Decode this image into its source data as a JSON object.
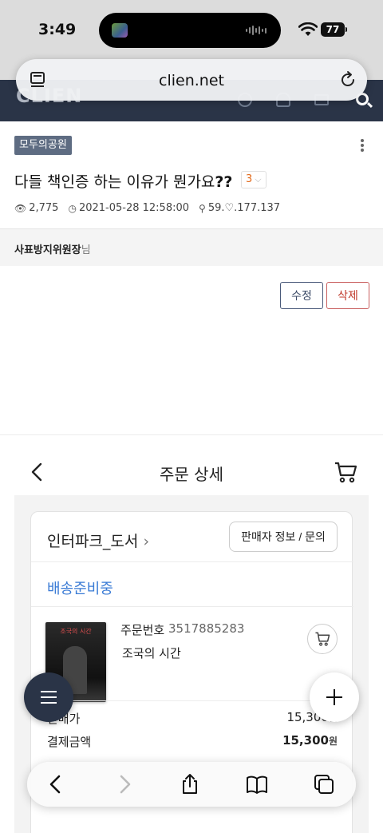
{
  "status_bar": {
    "time": "3:49",
    "battery": "77"
  },
  "browser": {
    "url": "clien.net"
  },
  "site": {
    "logo": "CLIEN"
  },
  "post": {
    "board": "모두의공원",
    "title_text": "다들 책인증 하는 이유가 뭔가요",
    "title_marks": "??",
    "comment_count": "3",
    "views": "2,775",
    "datetime": "2021-05-28 12:58:00",
    "ip": "59.♡.177.137",
    "author": "사표방지위원장",
    "author_suffix": "님",
    "edit_label": "수정",
    "delete_label": "삭제"
  },
  "order": {
    "header_title": "주문 상세",
    "seller": "인터파크_도서",
    "seller_button": "판매자 정보 / 문의",
    "status": "배송준비중",
    "book_cover_text": "조국의 시간",
    "order_no_label": "주문번호",
    "order_no": "3517885283",
    "book_title": "조국의 시간",
    "sale_price_label": "판매가",
    "sale_price": "15,300",
    "payment_label": "결제금액",
    "payment": "15,300",
    "currency": "원"
  }
}
